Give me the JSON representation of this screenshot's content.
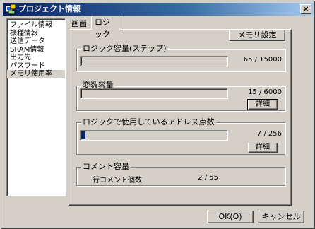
{
  "window": {
    "title": "プロジェクト情報",
    "icon": "project-info-icon",
    "close_label": "×"
  },
  "sidebar": {
    "items": [
      {
        "label": "ファイル情報",
        "selected": false
      },
      {
        "label": "機種情報",
        "selected": false
      },
      {
        "label": "送信データ",
        "selected": false
      },
      {
        "label": "SRAM情報",
        "selected": false
      },
      {
        "label": "出力先",
        "selected": false
      },
      {
        "label": "パスワード",
        "selected": false
      },
      {
        "label": "メモリ使用率",
        "selected": true
      }
    ]
  },
  "tabs": [
    {
      "label": "画面",
      "active": false
    },
    {
      "label": "ロジック",
      "active": true
    }
  ],
  "panel": {
    "memory_settings_label": "メモリ設定",
    "logic_capacity": {
      "title": "ロジック容量(ステップ)",
      "used": "65",
      "total": "15000",
      "fraction": 0.0043
    },
    "variable_capacity": {
      "title": "変数容量",
      "used": "15",
      "total": "6000",
      "fraction": 0.0025,
      "detail_label": "詳細"
    },
    "address_count": {
      "title": "ロジックで使用しているアドレス点数",
      "used": "7",
      "total": "256",
      "fraction": 0.027,
      "detail_label": "詳細"
    },
    "comment_capacity": {
      "title": "コメント容量",
      "row_label": "行コメント個数",
      "used": "2",
      "total": "55"
    },
    "separator": "/"
  },
  "footer": {
    "ok_label": "OK(O)",
    "cancel_label": "キャンセル"
  }
}
